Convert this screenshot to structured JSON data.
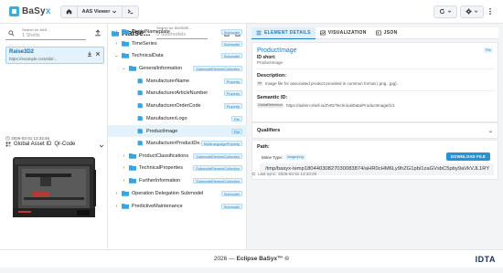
{
  "app": {
    "logo_text": "BaSy",
    "logo_text_accent": "x",
    "nav_label": "AAS Viewer",
    "accent": "#2494d8"
  },
  "sidebar": {
    "search_label": "Search for AAS...",
    "search_value": "1 Shells",
    "item_title": "Raise3D2",
    "item_url": "https://example.com/ids/...",
    "timestamp": "2026-03-31 13:33:46",
    "global_asset_label": "Global Asset ID",
    "global_asset_value": "Qr-Code",
    "close_label": "Close Sidebar"
  },
  "tree": {
    "title": "Raise...",
    "search_label": "Search for SM/SME...",
    "search_value": "5 Submodels",
    "rows": [
      {
        "label": "DigitalNameplate",
        "type": "Submodel"
      },
      {
        "label": "TimeSeries",
        "type": "Submodel"
      },
      {
        "label": "TechnicalData",
        "type": "Submodel"
      },
      {
        "label": "GeneralInformation",
        "type": "SubmodelElementCollection"
      },
      {
        "label": "ManufacturerName",
        "type": "Property"
      },
      {
        "label": "ManufacturerArticleNumber",
        "type": "Property"
      },
      {
        "label": "ManufacturerOrderCode",
        "type": "Property"
      },
      {
        "label": "ManufacturerLogo",
        "type": "File"
      },
      {
        "label": "ProductImage",
        "type": "File"
      },
      {
        "label": "ManufacturerProductDe...",
        "type": "MultiLanguageProperty"
      },
      {
        "label": "ProductClassifications",
        "type": "SubmodelElementCollection"
      },
      {
        "label": "TechnicalProperties",
        "type": "SubmodelElementCollection"
      },
      {
        "label": "FurtherInformation",
        "type": "SubmodelElementCollection"
      },
      {
        "label": "Operation Delegation Submodel",
        "type": "Submodel"
      },
      {
        "label": "PredictiveMaintenance",
        "type": "Submodel"
      }
    ]
  },
  "detail": {
    "tabs": [
      "ELEMENT DETAILS",
      "VISUALIZATION",
      "JSON"
    ],
    "title": "ProductImage",
    "type_badge": "File",
    "id_short_label": "ID short:",
    "id_short_value": "ProductImage",
    "description_label": "Description:",
    "description_lang": "en",
    "description_text": "Image file for associated product provided in common format (.png, .jpg).",
    "semantic_label": "Semantic ID:",
    "semantic_badge": "GlobalReference",
    "semantic_value": "https://admin-shell.io/ZVEI/TechnicalData/ProductImage/1/1",
    "qualifiers_label": "Qualifiers",
    "path_label": "Path:",
    "mime_label": "Mime Type:",
    "mime_value": "image/png",
    "download_label": "DOWNLOAD FILE",
    "path_value": "/tmp/basyx-temp18044030827030083874/aHR0cHM6Ly9hZG1pbi1zaGVsbC5pby9aVkVJL1RY",
    "last_sync_label": "Last sync:",
    "last_sync_value": "2026-03-31 13:33:29"
  },
  "footer": {
    "text": "2026 — ",
    "brand": "Eclipse BaSyx™ ©",
    "logo": "IDTA"
  }
}
